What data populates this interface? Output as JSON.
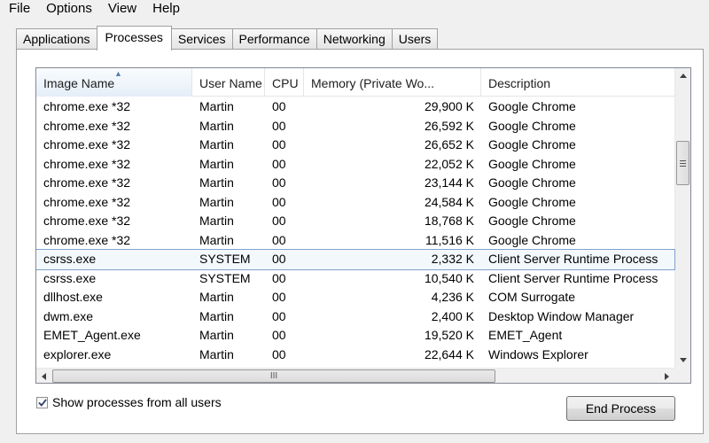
{
  "menu": [
    "File",
    "Options",
    "View",
    "Help"
  ],
  "tabs": [
    {
      "label": "Applications",
      "active": false
    },
    {
      "label": "Processes",
      "active": true
    },
    {
      "label": "Services",
      "active": false
    },
    {
      "label": "Performance",
      "active": false
    },
    {
      "label": "Networking",
      "active": false
    },
    {
      "label": "Users",
      "active": false
    }
  ],
  "table": {
    "columns": [
      "Image Name",
      "User Name",
      "CPU",
      "Memory (Private Wo...",
      "Description"
    ],
    "sorted_column": "Image Name",
    "rows": [
      [
        "chrome.exe *32",
        "Martin",
        "00",
        "29,900 K",
        "Google Chrome"
      ],
      [
        "chrome.exe *32",
        "Martin",
        "00",
        "26,592 K",
        "Google Chrome"
      ],
      [
        "chrome.exe *32",
        "Martin",
        "00",
        "26,652 K",
        "Google Chrome"
      ],
      [
        "chrome.exe *32",
        "Martin",
        "00",
        "22,052 K",
        "Google Chrome"
      ],
      [
        "chrome.exe *32",
        "Martin",
        "00",
        "23,144 K",
        "Google Chrome"
      ],
      [
        "chrome.exe *32",
        "Martin",
        "00",
        "24,584 K",
        "Google Chrome"
      ],
      [
        "chrome.exe *32",
        "Martin",
        "00",
        "18,768 K",
        "Google Chrome"
      ],
      [
        "chrome.exe *32",
        "Martin",
        "00",
        "11,516 K",
        "Google Chrome"
      ],
      [
        "csrss.exe",
        "SYSTEM",
        "00",
        "2,332 K",
        "Client Server Runtime Process"
      ],
      [
        "csrss.exe",
        "SYSTEM",
        "00",
        "10,540 K",
        "Client Server Runtime Process"
      ],
      [
        "dllhost.exe",
        "Martin",
        "00",
        "4,236 K",
        "COM Surrogate"
      ],
      [
        "dwm.exe",
        "Martin",
        "00",
        "2,400 K",
        "Desktop Window Manager"
      ],
      [
        "EMET_Agent.exe",
        "Martin",
        "00",
        "19,520 K",
        "EMET_Agent"
      ],
      [
        "explorer.exe",
        "Martin",
        "00",
        "22,644 K",
        "Windows Explorer"
      ]
    ],
    "selected_row": 8
  },
  "show_all_users": {
    "label": "Show processes from all users",
    "checked": true
  },
  "end_process_label": "End Process",
  "scroll": {
    "vertical_position": 0.2,
    "horizontal_thumb": "III"
  }
}
